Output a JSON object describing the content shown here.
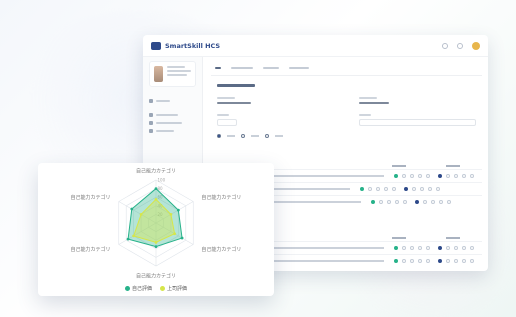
{
  "app": {
    "logo_text": "SmartSkill HCS"
  },
  "chart_data": {
    "type": "radar",
    "axes": [
      "自己能力カテゴリ",
      "自己能力カテゴリ",
      "自己能力カテゴリ",
      "自己能力カテゴリ",
      "自己能力カテゴリ",
      "自己能力カテゴリ"
    ],
    "rlim": [
      0,
      100
    ],
    "ticks": [
      20,
      40,
      60,
      80,
      100
    ],
    "series": [
      {
        "name": "自己評価",
        "color": "#27b28a",
        "values": [
          80,
          60,
          70,
          55,
          75,
          65
        ]
      },
      {
        "name": "上司評価",
        "color": "#d6e64a",
        "values": [
          55,
          40,
          50,
          45,
          60,
          40
        ]
      }
    ]
  }
}
